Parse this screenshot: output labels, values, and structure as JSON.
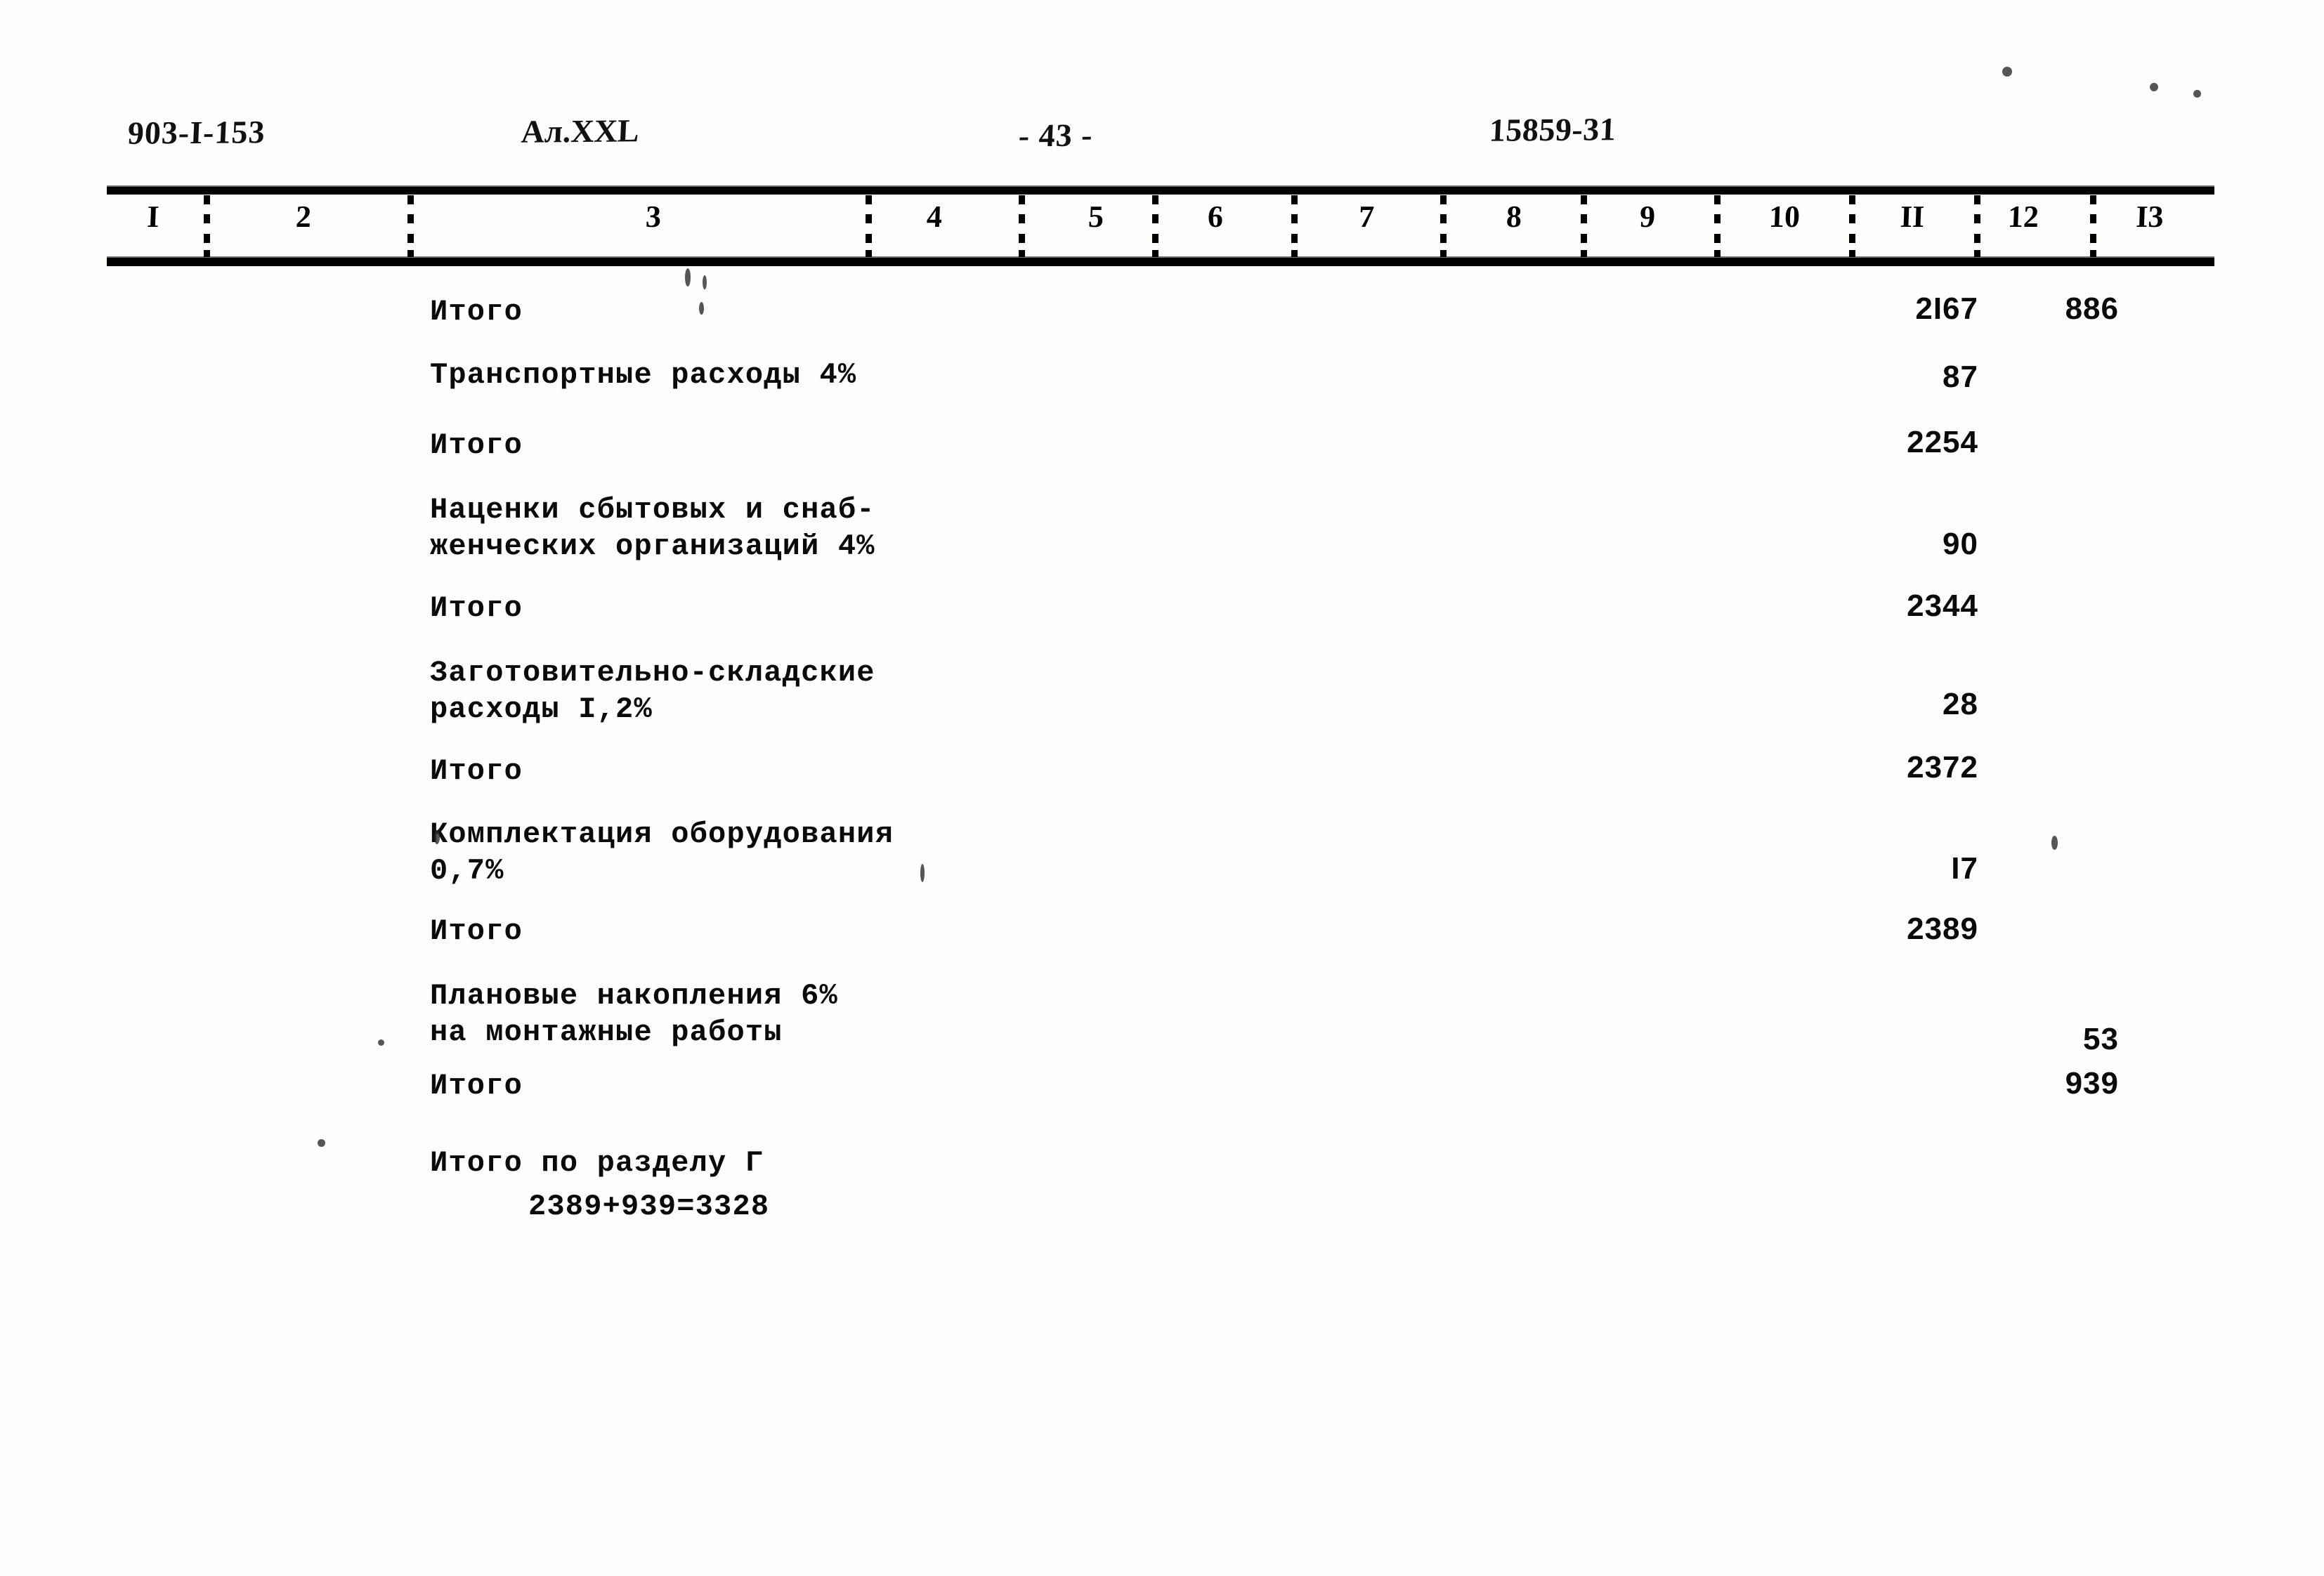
{
  "header": {
    "document_code": "903-I-153",
    "album": "Ал.XXL",
    "page_number": "- 43 -",
    "sheet_number": "15859-31"
  },
  "table": {
    "column_headers": [
      "I",
      "2",
      "3",
      "4",
      "5",
      "6",
      "7",
      "8",
      "9",
      "10",
      "II",
      "12",
      "I3"
    ],
    "rows": [
      {
        "description": "Итого",
        "col11": "2I67",
        "col12": "886"
      },
      {
        "description": "Транспортные расходы 4%",
        "col11": "87",
        "col12": ""
      },
      {
        "description": "Итого",
        "col11": "2254",
        "col12": ""
      },
      {
        "description": "Наценки сбытовых и снаб-\nженческих организаций 4%",
        "col11": "90",
        "col12": ""
      },
      {
        "description": "Итого",
        "col11": "2344",
        "col12": ""
      },
      {
        "description": "Заготовительно-складские\nрасходы I,2%",
        "col11": "28",
        "col12": ""
      },
      {
        "description": "Итого",
        "col11": "2372",
        "col12": ""
      },
      {
        "description": "Комплектация оборудования\n0,7%",
        "col11": "I7",
        "col12": ""
      },
      {
        "description": "Итого",
        "col11": "2389",
        "col12": ""
      },
      {
        "description": "Плановые накопления 6%\nна монтажные работы",
        "col11": "",
        "col12": "53"
      },
      {
        "description": "Итого",
        "col11": "",
        "col12": "939"
      }
    ],
    "summary": {
      "label": "Итого по разделу Г",
      "calculation": "2389+939=3328"
    }
  }
}
